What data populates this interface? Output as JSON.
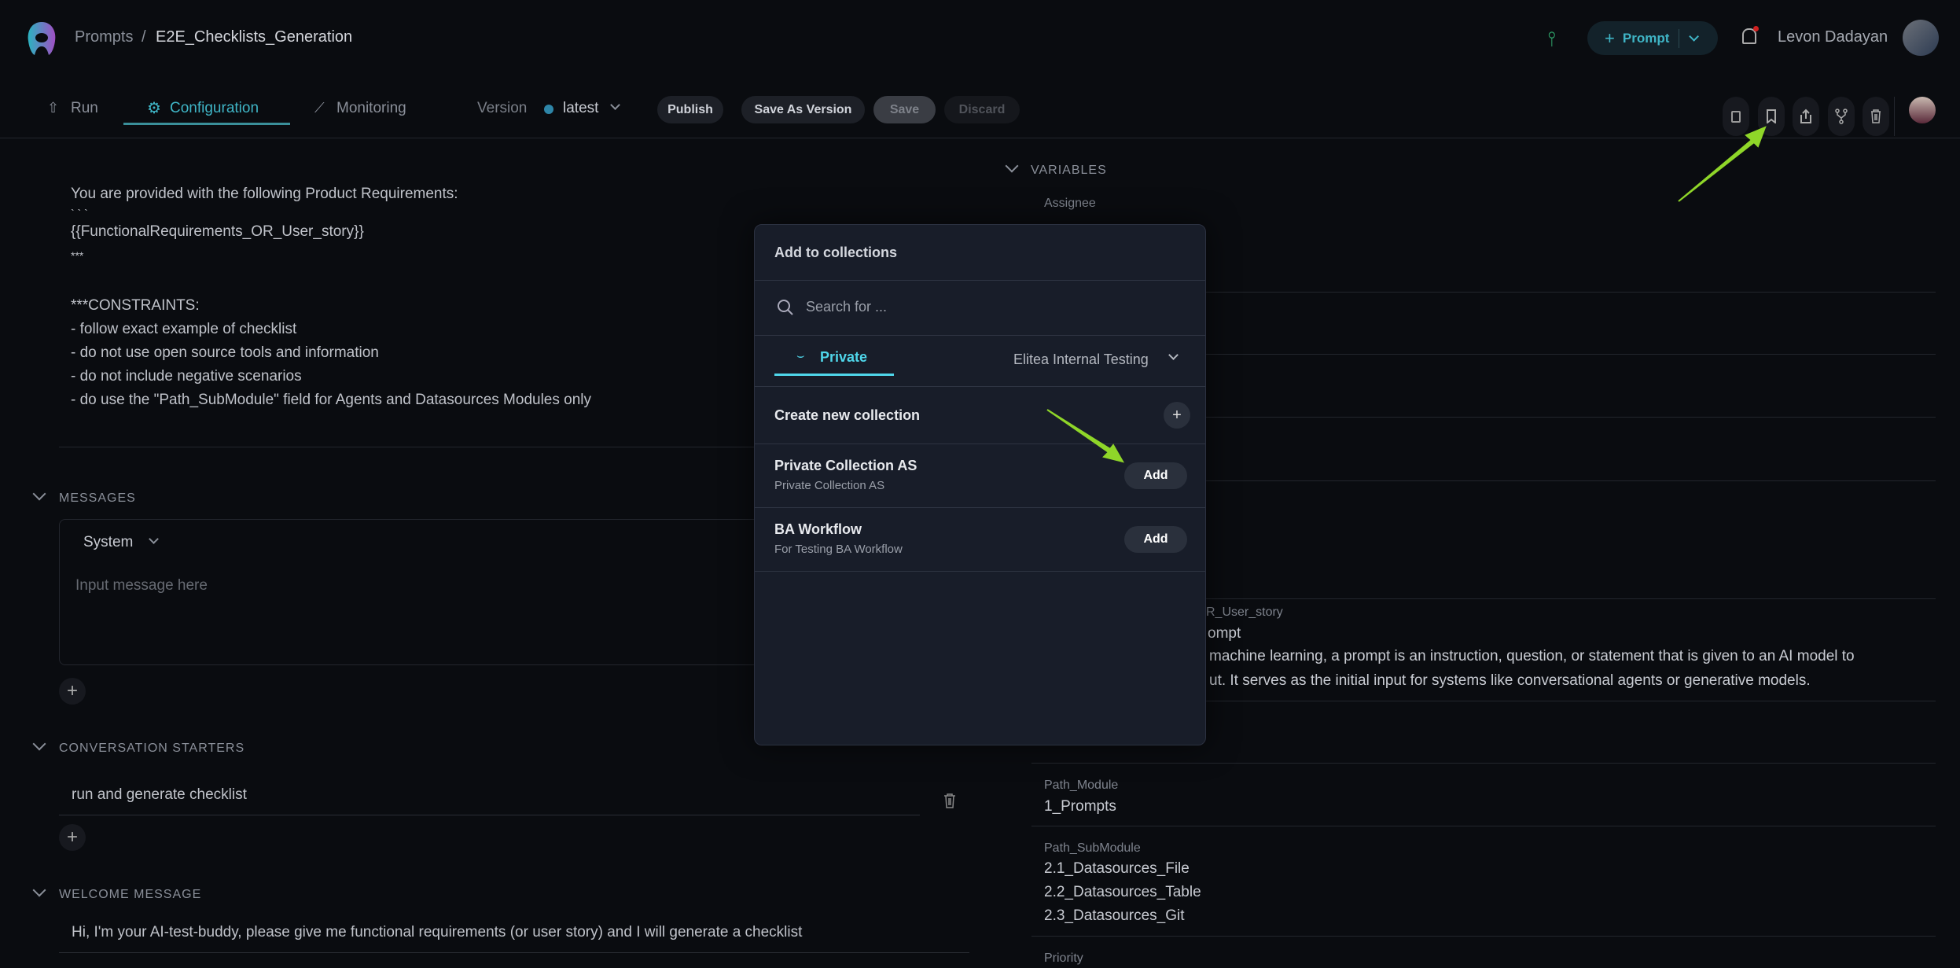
{
  "header": {
    "breadcrumb_root": "Prompts",
    "breadcrumb_sep": "/",
    "breadcrumb_current": "E2E_Checklists_Generation",
    "new_button": "Prompt",
    "user_name": "Levon Dadayan"
  },
  "tabs": [
    {
      "label": "Run"
    },
    {
      "label": "Configuration",
      "active": true
    },
    {
      "label": "Monitoring"
    }
  ],
  "version": {
    "label": "Version",
    "value": "latest"
  },
  "actions": {
    "publish": "Publish",
    "save_as_version": "Save As Version",
    "save": "Save",
    "discard": "Discard"
  },
  "prompt_lines": [
    "You are provided with the following Product Requirements:",
    "` ` `",
    "{{FunctionalRequirements_OR_User_story}}",
    "***",
    "",
    "***CONSTRAINTS:",
    "- follow exact example of checklist",
    "- do not use open source tools and information",
    "- do not include negative scenarios",
    "- do use the \"Path_SubModule\" field for Agents and Datasources Modules only"
  ],
  "messages": {
    "title": "MESSAGES",
    "role": "System",
    "placeholder": "Input message here"
  },
  "starters": {
    "title": "CONVERSATION STARTERS",
    "items": [
      "run and generate checklist"
    ]
  },
  "welcome": {
    "title": "WELCOME MESSAGE",
    "text": "Hi, I'm your AI-test-buddy, please give me functional requirements (or user story) and I will generate a checklist"
  },
  "variables": {
    "title": "VARIABLES",
    "assignee_label": "Assignee",
    "story_label_fragment": "R_User_story",
    "story_value_fragments": [
      "ompt",
      "machine learning, a prompt is an instruction, question, or statement that is given to an AI model to",
      "ut. It serves as the initial input for systems like conversational agents or generative models."
    ],
    "path_module_label": "Path_Module",
    "path_module_value": "1_Prompts",
    "path_submodule_label": "Path_SubModule",
    "path_submodule_values": [
      "2.1_Datasources_File",
      "2.2_Datasources_Table",
      "2.3_Datasources_Git"
    ],
    "priority_label": "Priority"
  },
  "modal": {
    "title": "Add to collections",
    "search_placeholder": "Search for ...",
    "tab_private": "Private",
    "project": "Elitea Internal Testing",
    "create_label": "Create new collection",
    "collections": [
      {
        "name": "Private Collection AS",
        "desc": "Private Collection AS",
        "action": "Add"
      },
      {
        "name": "BA Workflow",
        "desc": "For Testing BA Workflow",
        "action": "Add"
      }
    ]
  },
  "colors": {
    "accent": "#3fb5c6",
    "annotation_arrow": "#8fd629",
    "background": "#0a0c10",
    "modal": "#181d29"
  }
}
